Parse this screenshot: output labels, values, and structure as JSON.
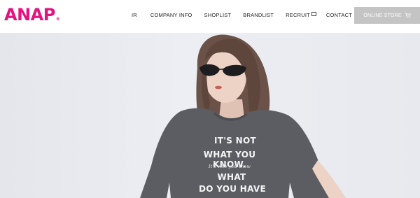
{
  "header": {
    "logo_text": "ANAP",
    "logo_mark": "®",
    "logo_color": "#e5127f",
    "nav": [
      {
        "label": "IR"
      },
      {
        "label": "COMPANY INFO"
      },
      {
        "label": "SHOPLIST"
      },
      {
        "label": "BRANDLIST"
      },
      {
        "label": "RECRUIT",
        "icon": "external-link-icon"
      },
      {
        "label": "CONTACT"
      }
    ],
    "store_button": {
      "label": "ONLINE STORE",
      "icon": "cart-icon",
      "background": "#c4c4c4"
    }
  },
  "hero": {
    "tshirt_print": {
      "line1": "IT'S NOT",
      "line2": "WHAT YOU KNOW.",
      "script": "It's who you know",
      "line3": "WHAT",
      "line4": "DO YOU HAVE"
    }
  }
}
